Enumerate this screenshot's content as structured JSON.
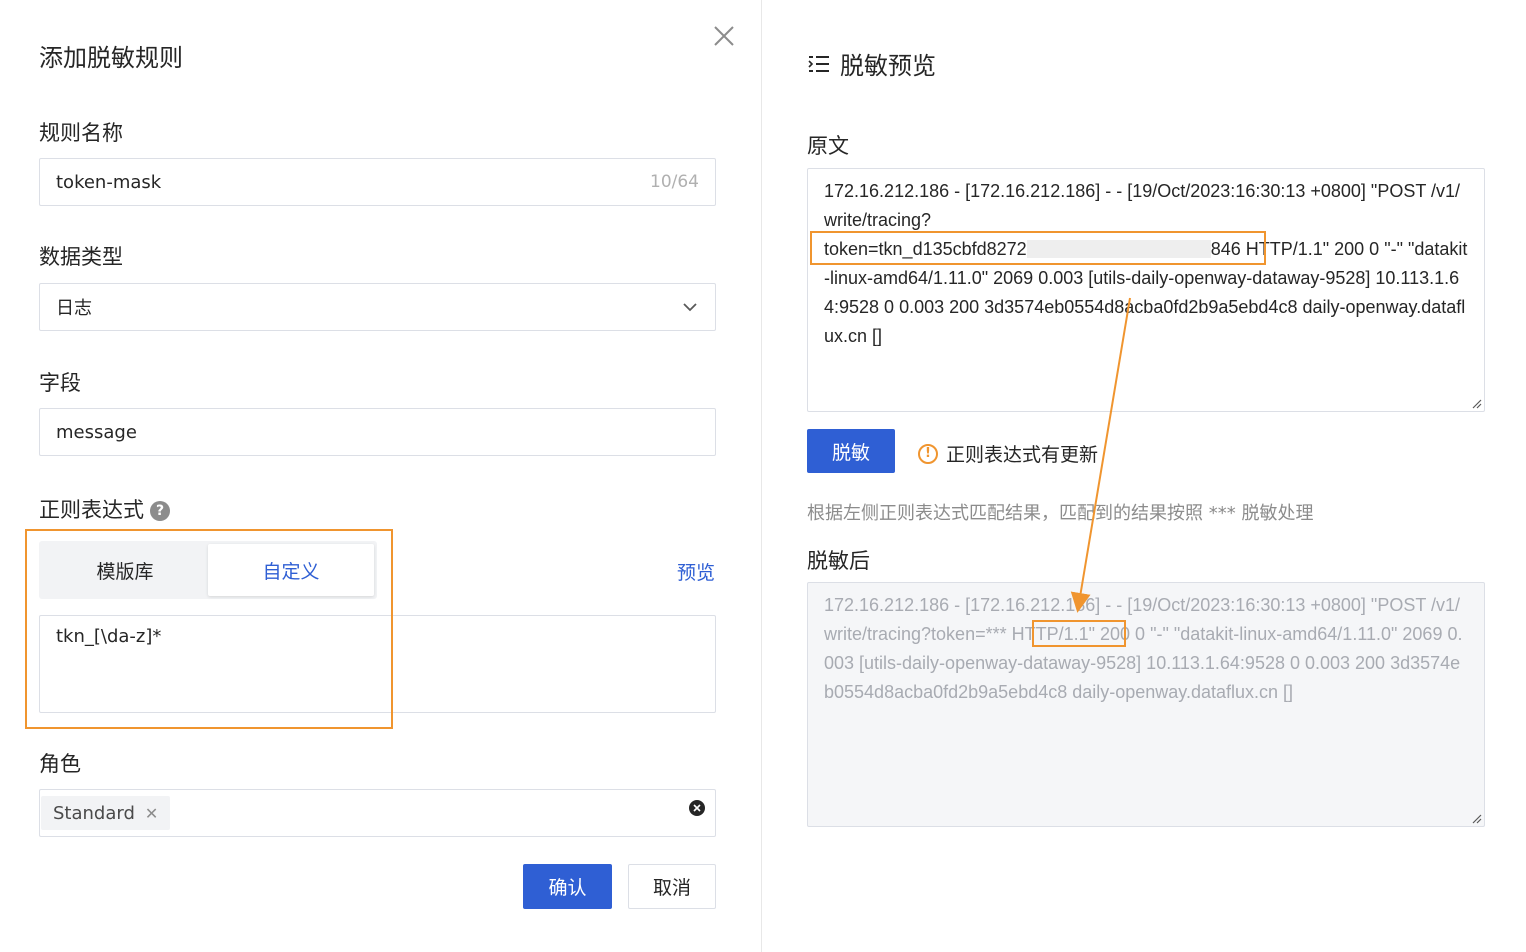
{
  "dialog": {
    "title": "添加脱敏规则",
    "rule_name": {
      "label": "规则名称",
      "value": "token-mask",
      "counter": "10/64"
    },
    "data_type": {
      "label": "数据类型",
      "value": "日志"
    },
    "field": {
      "label": "字段",
      "value": "message"
    },
    "regex": {
      "label": "正则表达式",
      "tabs": [
        {
          "label": "模版库"
        },
        {
          "label": "自定义"
        }
      ],
      "preview_link": "预览",
      "value": "tkn_[\\da-z]*"
    },
    "role": {
      "label": "角色",
      "tag": "Standard"
    },
    "buttons": {
      "confirm": "确认",
      "cancel": "取消"
    }
  },
  "preview": {
    "title": "脱敏预览",
    "original_label": "原文",
    "original_line1": "172.16.212.186 - [172.16.212.186] - - [19/Oct/2023:16:30:13 +0800] \"POST /v1/write/tracing?",
    "original_token_prefix": "token=tkn_d135cbfd8272",
    "original_token_suffix": "846",
    "original_rest": " HTTP/1.1\" 200 0 \"-\" \"datakit-linux-amd64/1.11.0\" 2069 0.003 [utils-daily-openway-dataway-9528] 10.113.1.64:9528 0 0.003 200 3d3574eb0554d8acba0fd2b9a5ebd4c8 daily-openway.dataflux.cn []",
    "mask_button": "脱敏",
    "warning": "正则表达式有更新",
    "description": "根据左侧正则表达式匹配结果，匹配到的结果按照 *** 脱敏处理",
    "masked_label": "脱敏后",
    "masked_before": "172.16.212.186 - [172.16.212.186] - - [19/Oct/2023:16:30:13 +0800] \"POST /v1/write/tracing?",
    "masked_token": "token=***",
    "masked_after": " HTTP/1.1\" 200 0 \"-\" \"datakit-linux-amd64/1.11.0\" 2069 0.003 [utils-daily-openway-dataway-9528] 10.113.1.64:9528 0 0.003 200 3d3574eb0554d8acba0fd2b9a5ebd4c8 daily-openway.dataflux.cn []"
  },
  "colors": {
    "primary": "#2f5fd4",
    "highlight": "#f0952f"
  }
}
